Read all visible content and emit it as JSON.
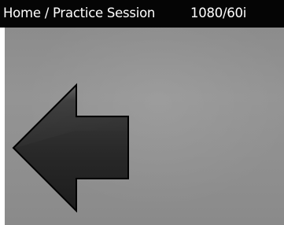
{
  "header": {
    "breadcrumb": "Home / Practice Session",
    "resolution": "1080/60i"
  },
  "viewport": {
    "background": "#8f8f8f"
  },
  "controls": {
    "back_arrow_icon": "left-arrow-icon",
    "back_arrow_color": "#2b2b2b"
  }
}
